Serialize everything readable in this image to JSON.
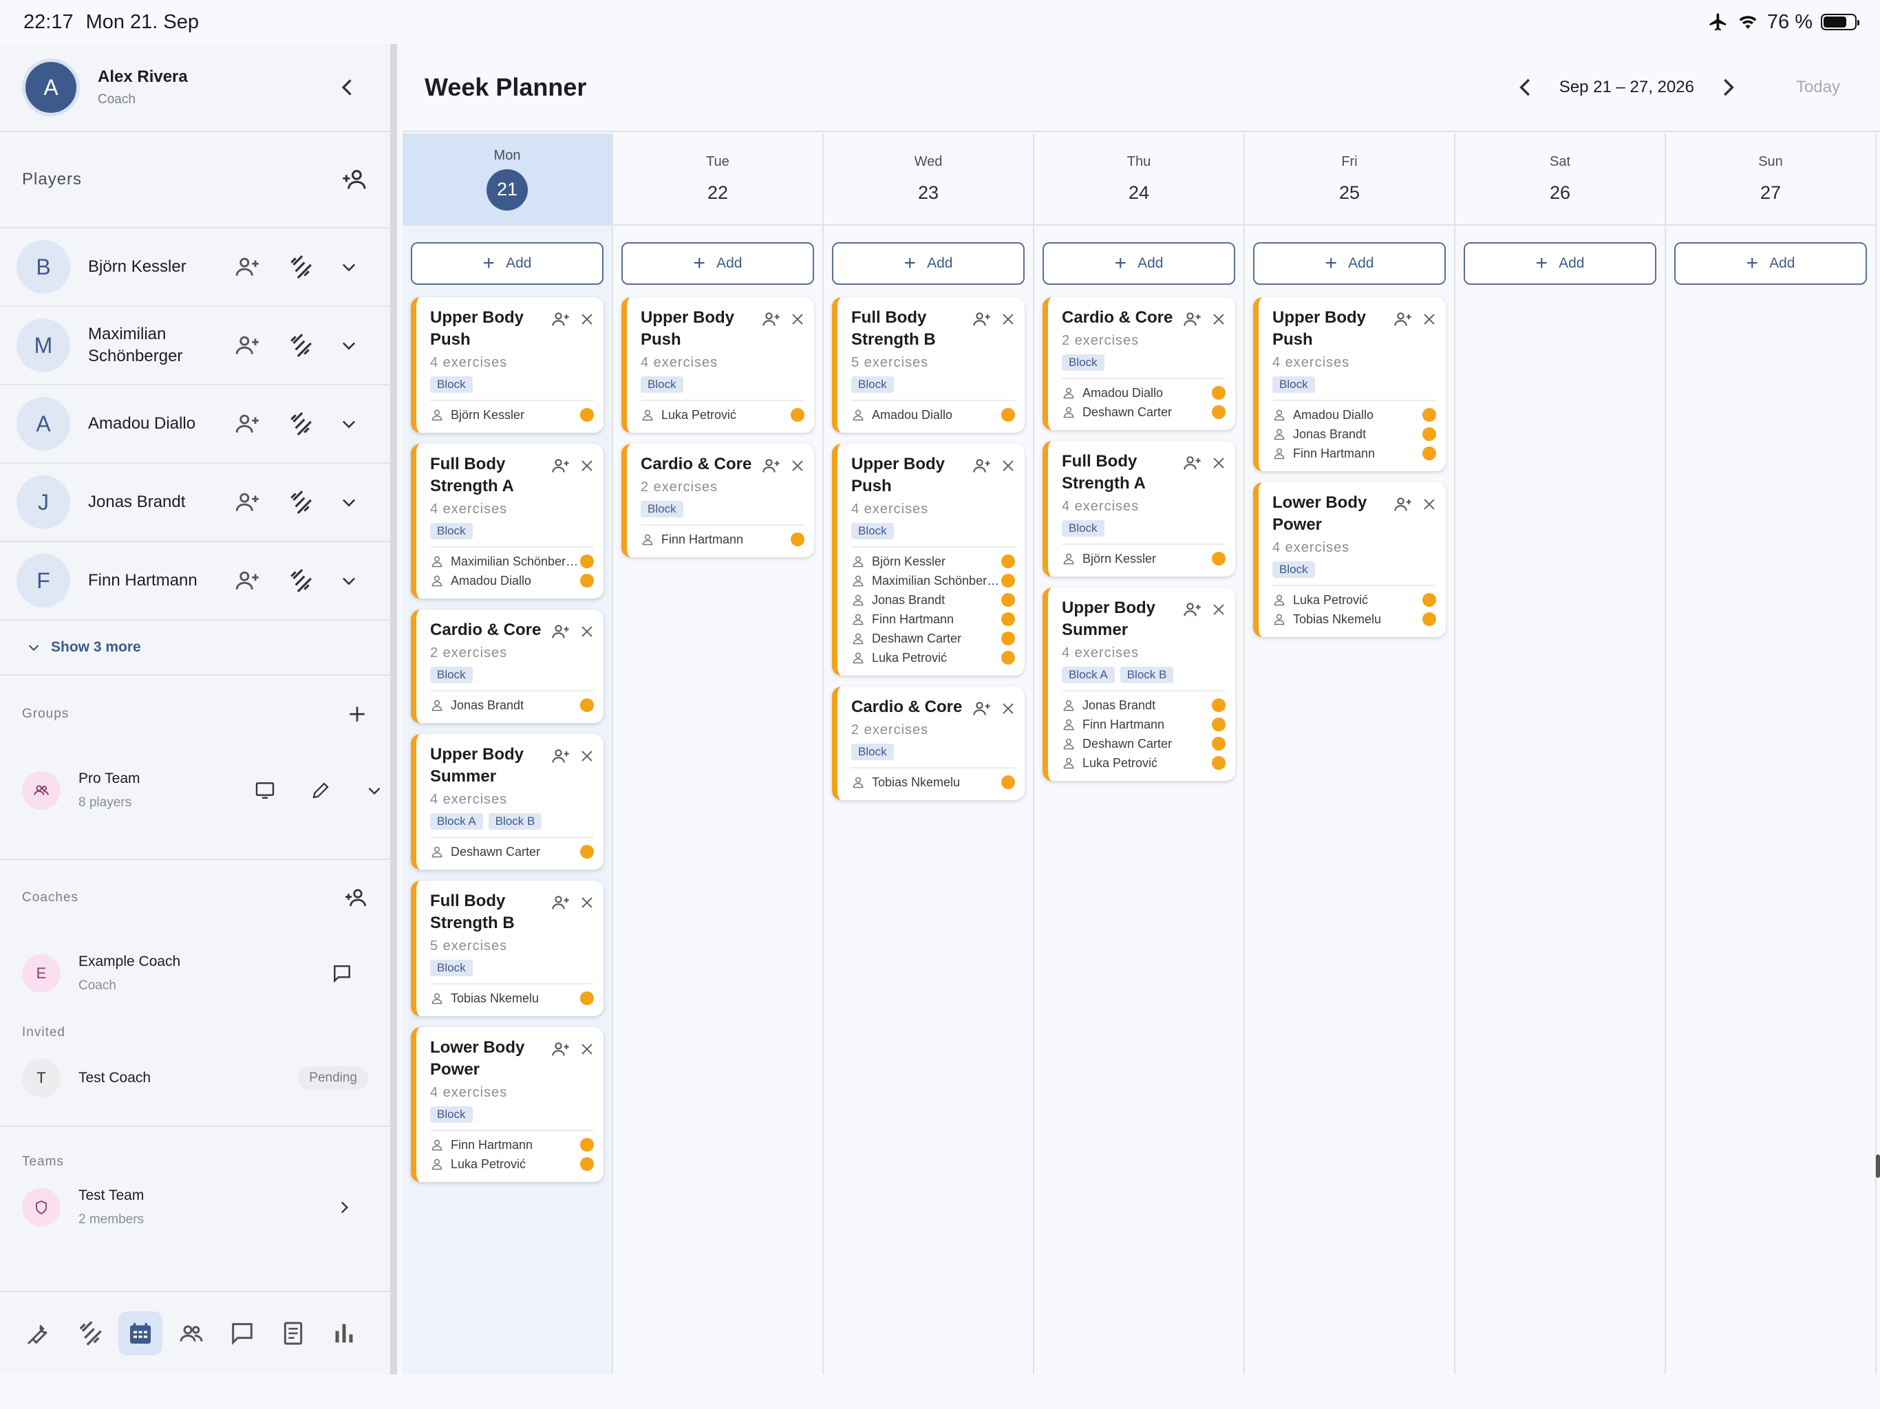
{
  "status": {
    "time": "22:17",
    "date": "Mon 21. Sep",
    "battery": "76 %",
    "battery_level": 0.76
  },
  "profile": {
    "initial": "A",
    "name": "Alex Rivera",
    "role": "Coach"
  },
  "players": {
    "title": "Players",
    "items": [
      {
        "initial": "B",
        "name": "Björn Kessler"
      },
      {
        "initial": "M",
        "name": "Maximilian Schönberger"
      },
      {
        "initial": "A",
        "name": "Amadou Diallo"
      },
      {
        "initial": "J",
        "name": "Jonas Brandt"
      },
      {
        "initial": "F",
        "name": "Finn Hartmann"
      }
    ],
    "show_more": "Show 3 more"
  },
  "groups": {
    "title": "Groups",
    "item": {
      "name": "Pro Team",
      "sub": "8 players"
    }
  },
  "coaches": {
    "title": "Coaches",
    "item": {
      "initial": "E",
      "name": "Example Coach",
      "sub": "Coach"
    },
    "invited_label": "Invited",
    "invited": {
      "initial": "T",
      "name": "Test Coach",
      "status": "Pending"
    }
  },
  "teams": {
    "title": "Teams",
    "item": {
      "name": "Test Team",
      "sub": "2 members"
    }
  },
  "header": {
    "title": "Week Planner",
    "range": "Sep 21 – 27, 2026",
    "today": "Today"
  },
  "add_label": "Add",
  "days": [
    {
      "dow": "Mon",
      "num": "21",
      "today": true,
      "cards": [
        {
          "title": "Upper Body Push",
          "ex": "4 exercises",
          "tags": [
            "Block"
          ],
          "people": [
            "Björn Kessler"
          ]
        },
        {
          "title": "Full Body Strength A",
          "ex": "4 exercises",
          "tags": [
            "Block"
          ],
          "people": [
            "Maximilian Schönberger",
            "Amadou Diallo"
          ]
        },
        {
          "title": "Cardio & Core",
          "ex": "2 exercises",
          "tags": [
            "Block"
          ],
          "people": [
            "Jonas Brandt"
          ]
        },
        {
          "title": "Upper Body Summer",
          "ex": "4 exercises",
          "tags": [
            "Block A",
            "Block B"
          ],
          "people": [
            "Deshawn Carter"
          ]
        },
        {
          "title": "Full Body Strength B",
          "ex": "5 exercises",
          "tags": [
            "Block"
          ],
          "people": [
            "Tobias Nkemelu"
          ]
        },
        {
          "title": "Lower Body Power",
          "ex": "4 exercises",
          "tags": [
            "Block"
          ],
          "people": [
            "Finn Hartmann",
            "Luka Petrović"
          ]
        }
      ]
    },
    {
      "dow": "Tue",
      "num": "22",
      "cards": [
        {
          "title": "Upper Body Push",
          "ex": "4 exercises",
          "tags": [
            "Block"
          ],
          "people": [
            "Luka Petrović"
          ]
        },
        {
          "title": "Cardio & Core",
          "ex": "2 exercises",
          "tags": [
            "Block"
          ],
          "people": [
            "Finn Hartmann"
          ]
        }
      ]
    },
    {
      "dow": "Wed",
      "num": "23",
      "cards": [
        {
          "title": "Full Body Strength B",
          "ex": "5 exercises",
          "tags": [
            "Block"
          ],
          "people": [
            "Amadou Diallo"
          ]
        },
        {
          "title": "Upper Body Push",
          "ex": "4 exercises",
          "tags": [
            "Block"
          ],
          "people": [
            "Björn Kessler",
            "Maximilian Schönberger",
            "Jonas Brandt",
            "Finn Hartmann",
            "Deshawn Carter",
            "Luka Petrović"
          ]
        },
        {
          "title": "Cardio & Core",
          "ex": "2 exercises",
          "tags": [
            "Block"
          ],
          "people": [
            "Tobias Nkemelu"
          ]
        }
      ]
    },
    {
      "dow": "Thu",
      "num": "24",
      "cards": [
        {
          "title": "Cardio & Core",
          "ex": "2 exercises",
          "tags": [
            "Block"
          ],
          "people": [
            "Amadou Diallo",
            "Deshawn Carter"
          ]
        },
        {
          "title": "Full Body Strength A",
          "ex": "4 exercises",
          "tags": [
            "Block"
          ],
          "people": [
            "Björn Kessler"
          ]
        },
        {
          "title": "Upper Body Summer",
          "ex": "4 exercises",
          "tags": [
            "Block A",
            "Block B"
          ],
          "people": [
            "Jonas Brandt",
            "Finn Hartmann",
            "Deshawn Carter",
            "Luka Petrović"
          ]
        }
      ]
    },
    {
      "dow": "Fri",
      "num": "25",
      "cards": [
        {
          "title": "Upper Body Push",
          "ex": "4 exercises",
          "tags": [
            "Block"
          ],
          "people": [
            "Amadou Diallo",
            "Jonas Brandt",
            "Finn Hartmann"
          ]
        },
        {
          "title": "Lower Body Power",
          "ex": "4 exercises",
          "tags": [
            "Block"
          ],
          "people": [
            "Luka Petrović",
            "Tobias Nkemelu"
          ]
        }
      ]
    },
    {
      "dow": "Sat",
      "num": "26",
      "cards": []
    },
    {
      "dow": "Sun",
      "num": "27",
      "cards": []
    }
  ],
  "colors": {
    "accent": "#3d5a8c",
    "card_stripe": "#f4a11c",
    "status_dot": "#f5a316"
  }
}
